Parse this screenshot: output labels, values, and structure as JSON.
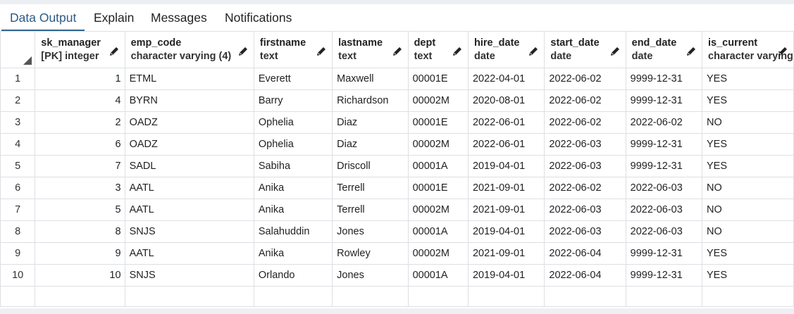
{
  "tabs": [
    {
      "label": "Data Output",
      "active": true
    },
    {
      "label": "Explain",
      "active": false
    },
    {
      "label": "Messages",
      "active": false
    },
    {
      "label": "Notifications",
      "active": false
    }
  ],
  "columns": [
    {
      "name": "sk_manager",
      "type": "[PK] integer"
    },
    {
      "name": "emp_code",
      "type": "character varying (4)"
    },
    {
      "name": "firstname",
      "type": "text"
    },
    {
      "name": "lastname",
      "type": "text"
    },
    {
      "name": "dept",
      "type": "text"
    },
    {
      "name": "hire_date",
      "type": "date"
    },
    {
      "name": "start_date",
      "type": "date"
    },
    {
      "name": "end_date",
      "type": "date"
    },
    {
      "name": "is_current",
      "type": "character varying"
    }
  ],
  "rows": [
    {
      "n": "1",
      "cells": [
        "1",
        "ETML",
        "Everett",
        "Maxwell",
        "00001E",
        "2022-04-01",
        "2022-06-02",
        "9999-12-31",
        "YES"
      ]
    },
    {
      "n": "2",
      "cells": [
        "4",
        "BYRN",
        "Barry",
        "Richardson",
        "00002M",
        "2020-08-01",
        "2022-06-02",
        "9999-12-31",
        "YES"
      ]
    },
    {
      "n": "3",
      "cells": [
        "2",
        "OADZ",
        "Ophelia",
        "Diaz",
        "00001E",
        "2022-06-01",
        "2022-06-02",
        "2022-06-02",
        "NO"
      ]
    },
    {
      "n": "4",
      "cells": [
        "6",
        "OADZ",
        "Ophelia",
        "Diaz",
        "00002M",
        "2022-06-01",
        "2022-06-03",
        "9999-12-31",
        "YES"
      ]
    },
    {
      "n": "5",
      "cells": [
        "7",
        "SADL",
        "Sabiha",
        "Driscoll",
        "00001A",
        "2019-04-01",
        "2022-06-03",
        "9999-12-31",
        "YES"
      ]
    },
    {
      "n": "6",
      "cells": [
        "3",
        "AATL",
        "Anika",
        "Terrell",
        "00001E",
        "2021-09-01",
        "2022-06-02",
        "2022-06-03",
        "NO"
      ]
    },
    {
      "n": "7",
      "cells": [
        "5",
        "AATL",
        "Anika",
        "Terrell",
        "00002M",
        "2021-09-01",
        "2022-06-03",
        "2022-06-03",
        "NO"
      ]
    },
    {
      "n": "8",
      "cells": [
        "8",
        "SNJS",
        "Salahuddin",
        "Jones",
        "00001A",
        "2019-04-01",
        "2022-06-03",
        "2022-06-03",
        "NO"
      ]
    },
    {
      "n": "9",
      "cells": [
        "9",
        "AATL",
        "Anika",
        "Rowley",
        "00002M",
        "2021-09-01",
        "2022-06-04",
        "9999-12-31",
        "YES"
      ]
    },
    {
      "n": "10",
      "cells": [
        "10",
        "SNJS",
        "Orlando",
        "Jones",
        "00001A",
        "2019-04-01",
        "2022-06-04",
        "9999-12-31",
        "YES"
      ]
    }
  ],
  "icons": {
    "edit": "pencil-icon",
    "sort": "sort-corner-icon"
  },
  "colors": {
    "accent": "#326690",
    "grid_line": "#dcdfe4"
  }
}
